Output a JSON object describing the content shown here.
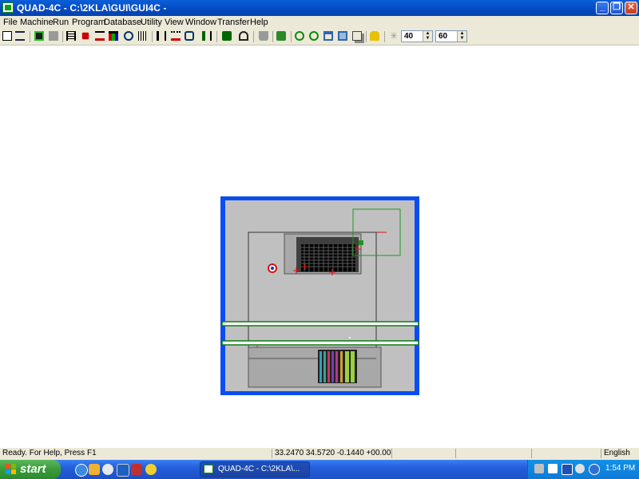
{
  "window": {
    "title": "QUAD-4C - C:\\2KLA\\GUI\\GUI4C -",
    "minimize_label": "_",
    "maximize_label": "❐",
    "close_label": "✕"
  },
  "menu": [
    "File",
    "Machine",
    "Run",
    "Program",
    "Database",
    "Utility",
    "View",
    "Window",
    "Transfer",
    "Help"
  ],
  "toolbar": {
    "spin1_value": "40",
    "spin2_value": "60",
    "icons": [
      "new-icon",
      "connect-icon",
      "green-map-icon",
      "gray-block-icon",
      "comb-icon",
      "chip-icon",
      "probe-icon",
      "chart-icon",
      "zoom-search-icon",
      "barcode-icon",
      "help-query-icon",
      "ruler-icon",
      "wizard-icon",
      "align-icon",
      "gift-icon",
      "people-icon",
      "flask-icon",
      "stage-move-icon",
      "zoom-in-icon",
      "zoom-out-icon",
      "window-icon",
      "window-fit-icon",
      "layers-icon",
      "lock-icon",
      "light-icon"
    ]
  },
  "statusbar": {
    "message": "Ready. For Help, Press F1",
    "coordinates": "33.2470 34.5720 -0.1440 +00.00",
    "language": "English"
  },
  "taskbar": {
    "start_label": "start",
    "task_label": "QUAD-4C - C:\\2KLA\\...",
    "clock": "1:54 PM"
  },
  "colors": {
    "frame_blue": "#0b4df0",
    "stage_gray": "#c0c0c0",
    "chip_dark": "#3a3a3a",
    "rail_green": "#0d7a16",
    "mark_red": "#e01010",
    "window_green": "#1a9a1a"
  }
}
